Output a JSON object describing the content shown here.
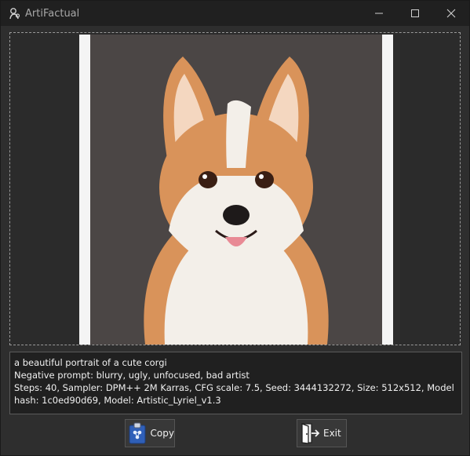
{
  "window": {
    "title": "ArtiFactual",
    "icon": "app-logo-icon",
    "controls": [
      "minimize-icon",
      "maximize-icon",
      "close-icon"
    ]
  },
  "image": {
    "subject_icon": "corgi-portrait-image"
  },
  "prompt": {
    "line1": "a beautiful portrait of a cute corgi",
    "line2": "Negative prompt: blurry, ugly, unfocused, bad artist",
    "line3": "Steps: 40, Sampler: DPM++ 2M Karras, CFG scale: 7.5, Seed: 3444132272, Size: 512x512, Model hash: 1c0ed90d69, Model: Artistic_Lyriel_v1.3"
  },
  "buttons": {
    "copy_label": "Copy",
    "copy_icon": "clipboard-icon",
    "exit_label": "Exit",
    "exit_icon": "door-exit-icon"
  },
  "colors": {
    "titlebar": "#202020",
    "window_bg": "#2e2e2e",
    "image_bg": "#4b4645",
    "corgi_orange": "#d9935a",
    "corgi_white": "#f3efe9"
  }
}
